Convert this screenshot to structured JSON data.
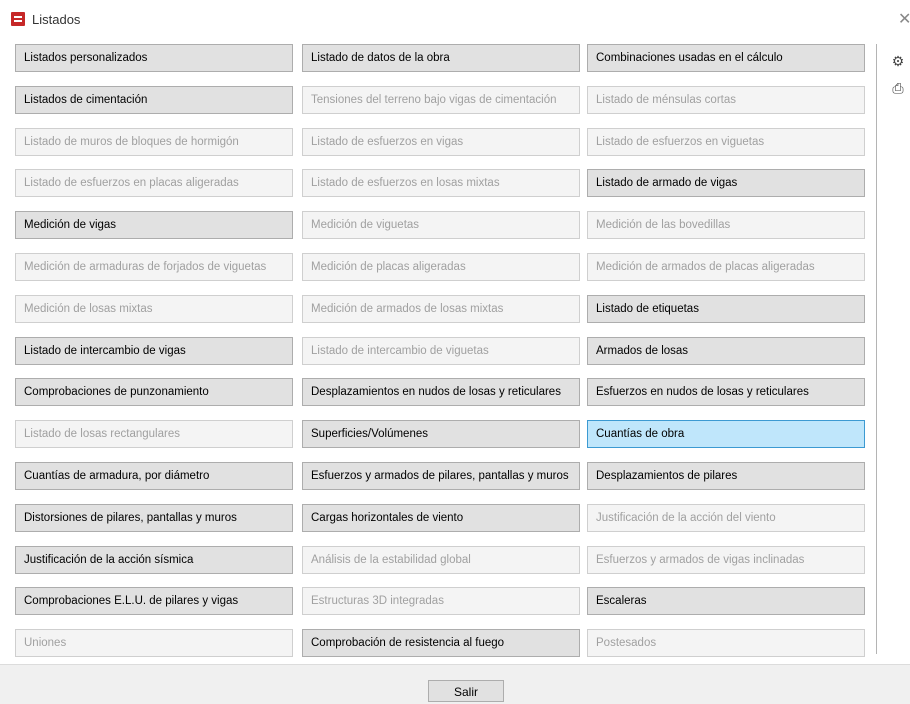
{
  "window": {
    "title": "Listados"
  },
  "side_toolbar": {
    "icons": [
      "settings-gear-icon",
      "printer-icon"
    ]
  },
  "buttons": [
    [
      {
        "label": "Listados personalizados",
        "enabled": true,
        "selected": false
      },
      {
        "label": "Listado de datos de la obra",
        "enabled": true,
        "selected": false
      },
      {
        "label": "Combinaciones usadas en el cálculo",
        "enabled": true,
        "selected": false
      }
    ],
    [
      {
        "label": "Listados de cimentación",
        "enabled": true,
        "selected": false
      },
      {
        "label": "Tensiones del terreno bajo vigas de cimentación",
        "enabled": false,
        "selected": false
      },
      {
        "label": "Listado de ménsulas cortas",
        "enabled": false,
        "selected": false
      }
    ],
    [
      {
        "label": "Listado de muros de bloques de hormigón",
        "enabled": false,
        "selected": false
      },
      {
        "label": "Listado de esfuerzos en vigas",
        "enabled": false,
        "selected": false
      },
      {
        "label": "Listado de esfuerzos en viguetas",
        "enabled": false,
        "selected": false
      }
    ],
    [
      {
        "label": "Listado de esfuerzos en placas aligeradas",
        "enabled": false,
        "selected": false
      },
      {
        "label": "Listado de esfuerzos en losas mixtas",
        "enabled": false,
        "selected": false
      },
      {
        "label": "Listado de armado de vigas",
        "enabled": true,
        "selected": false
      }
    ],
    [
      {
        "label": "Medición de vigas",
        "enabled": true,
        "selected": false
      },
      {
        "label": "Medición de viguetas",
        "enabled": false,
        "selected": false
      },
      {
        "label": "Medición de las bovedillas",
        "enabled": false,
        "selected": false
      }
    ],
    [
      {
        "label": "Medición de armaduras de forjados de viguetas",
        "enabled": false,
        "selected": false
      },
      {
        "label": "Medición de placas aligeradas",
        "enabled": false,
        "selected": false
      },
      {
        "label": "Medición de armados de placas aligeradas",
        "enabled": false,
        "selected": false
      }
    ],
    [
      {
        "label": "Medición de losas mixtas",
        "enabled": false,
        "selected": false
      },
      {
        "label": "Medición de armados de losas mixtas",
        "enabled": false,
        "selected": false
      },
      {
        "label": "Listado de etiquetas",
        "enabled": true,
        "selected": false
      }
    ],
    [
      {
        "label": "Listado de intercambio de vigas",
        "enabled": true,
        "selected": false
      },
      {
        "label": "Listado de intercambio de viguetas",
        "enabled": false,
        "selected": false
      },
      {
        "label": "Armados de losas",
        "enabled": true,
        "selected": false
      }
    ],
    [
      {
        "label": "Comprobaciones de punzonamiento",
        "enabled": true,
        "selected": false
      },
      {
        "label": "Desplazamientos en nudos de losas y reticulares",
        "enabled": true,
        "selected": false
      },
      {
        "label": "Esfuerzos en nudos de losas y reticulares",
        "enabled": true,
        "selected": false
      }
    ],
    [
      {
        "label": "Listado de losas rectangulares",
        "enabled": false,
        "selected": false
      },
      {
        "label": "Superficies/Volúmenes",
        "enabled": true,
        "selected": false
      },
      {
        "label": "Cuantías de obra",
        "enabled": true,
        "selected": true
      }
    ],
    [
      {
        "label": "Cuantías de armadura, por diámetro",
        "enabled": true,
        "selected": false
      },
      {
        "label": "Esfuerzos y armados de pilares, pantallas y muros",
        "enabled": true,
        "selected": false
      },
      {
        "label": "Desplazamientos de pilares",
        "enabled": true,
        "selected": false
      }
    ],
    [
      {
        "label": "Distorsiones de pilares, pantallas y muros",
        "enabled": true,
        "selected": false
      },
      {
        "label": "Cargas horizontales de viento",
        "enabled": true,
        "selected": false
      },
      {
        "label": "Justificación de la acción del viento",
        "enabled": false,
        "selected": false
      }
    ],
    [
      {
        "label": "Justificación de la acción sísmica",
        "enabled": true,
        "selected": false
      },
      {
        "label": "Análisis de la estabilidad global",
        "enabled": false,
        "selected": false
      },
      {
        "label": "Esfuerzos y armados de vigas inclinadas",
        "enabled": false,
        "selected": false
      }
    ],
    [
      {
        "label": "Comprobaciones E.L.U. de pilares y vigas",
        "enabled": true,
        "selected": false
      },
      {
        "label": "Estructuras 3D integradas",
        "enabled": false,
        "selected": false
      },
      {
        "label": "Escaleras",
        "enabled": true,
        "selected": false
      }
    ],
    [
      {
        "label": "Uniones",
        "enabled": false,
        "selected": false
      },
      {
        "label": "Comprobación de resistencia al fuego",
        "enabled": true,
        "selected": false
      },
      {
        "label": "Postesados",
        "enabled": false,
        "selected": false
      }
    ]
  ],
  "footer": {
    "exit_label": "Salir"
  },
  "colors": {
    "selected_bg": "#bfe6fb",
    "selected_border": "#3c9ad2",
    "disabled_text": "#a0a0a0"
  }
}
